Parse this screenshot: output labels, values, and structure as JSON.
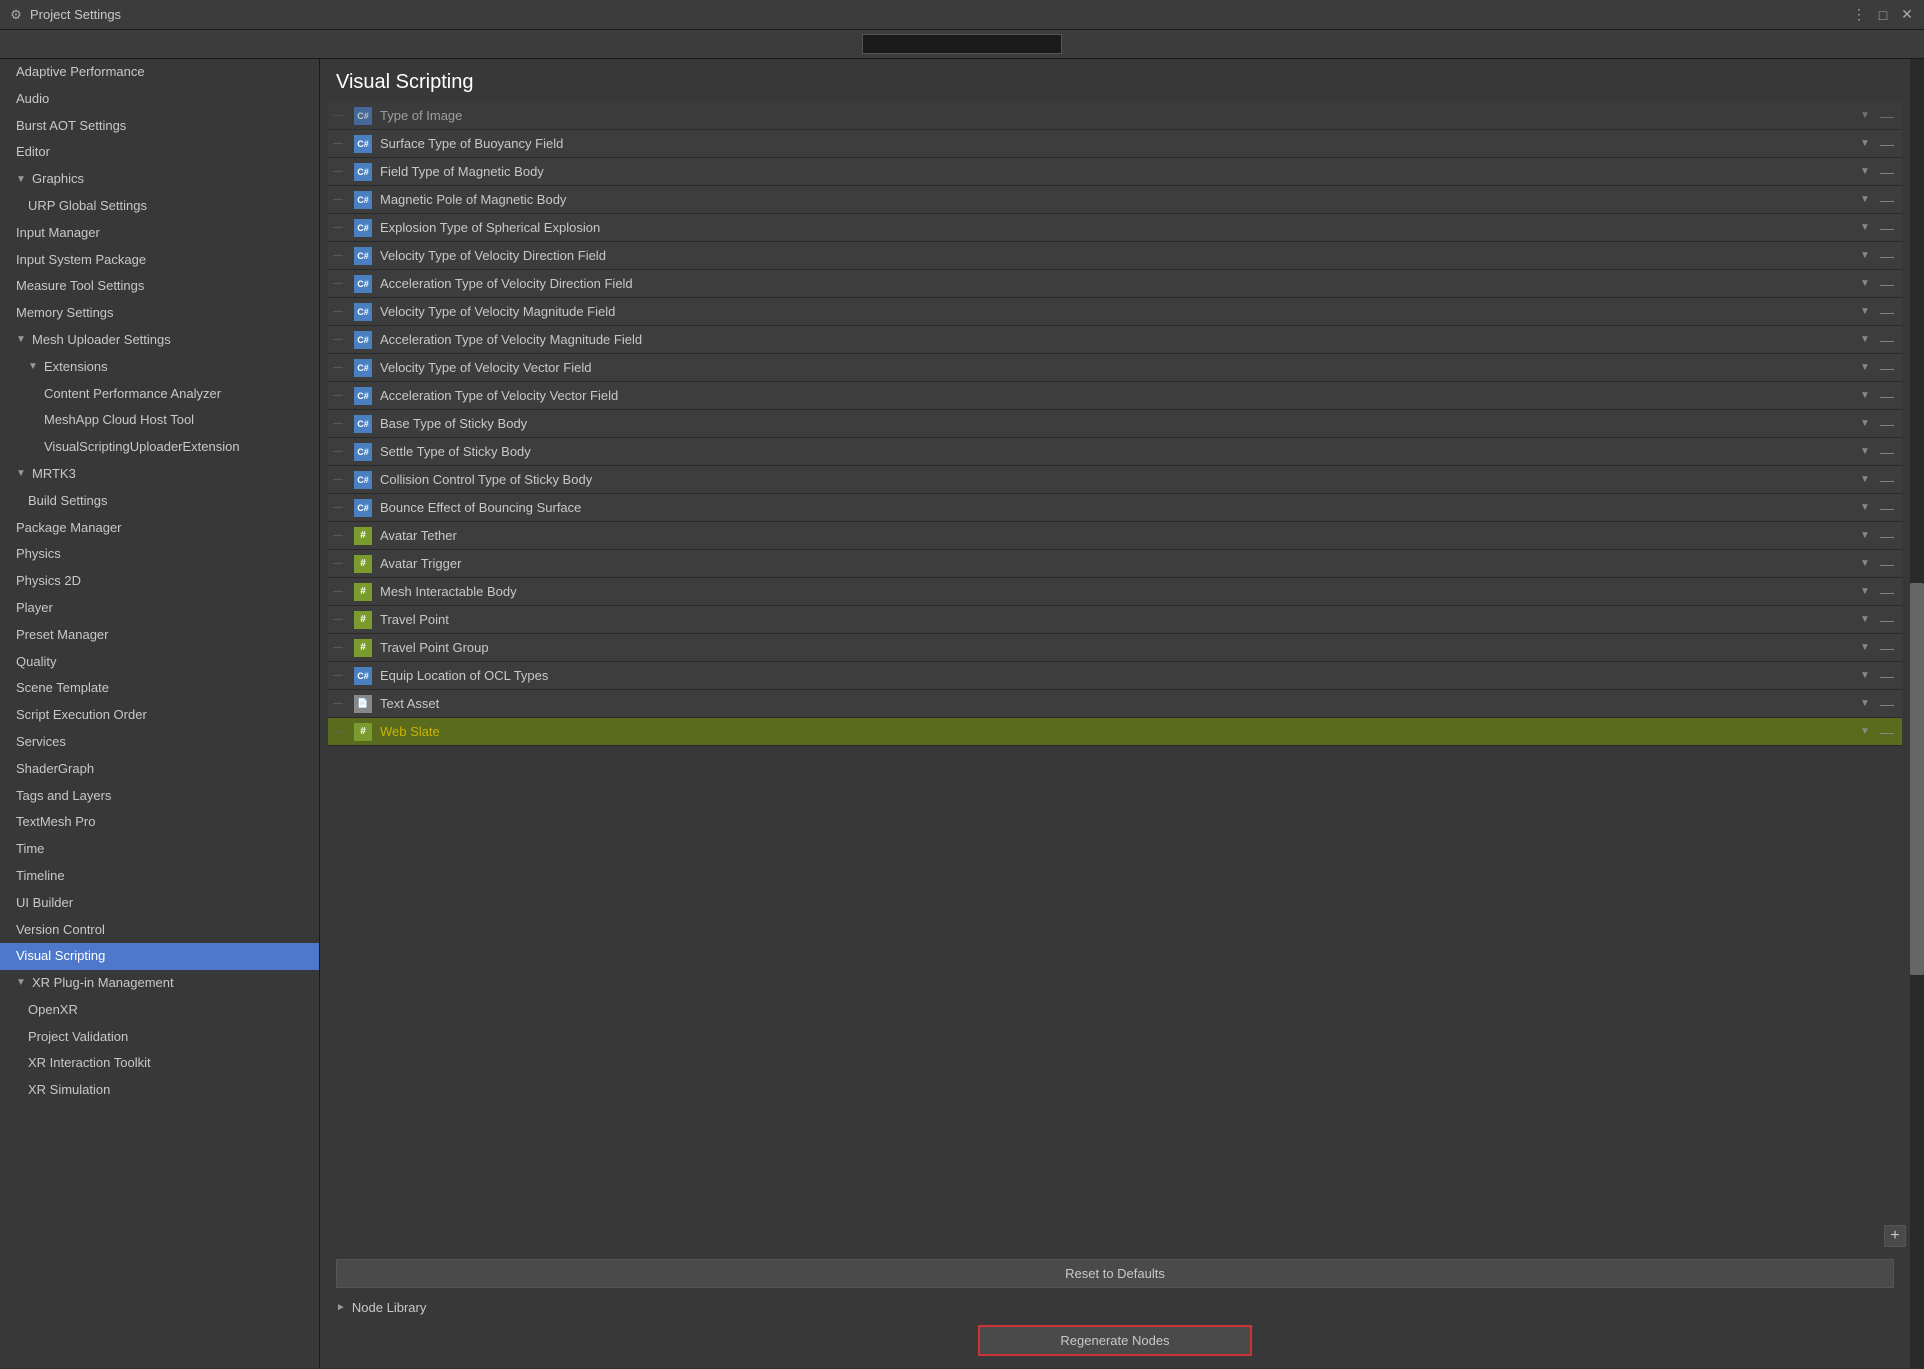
{
  "titlebar": {
    "title": "Project Settings",
    "icon": "⚙",
    "controls": [
      "⋮",
      "□",
      "✕"
    ]
  },
  "search": {
    "placeholder": ""
  },
  "sidebar": {
    "items": [
      {
        "id": "adaptive-performance",
        "label": "Adaptive Performance",
        "indent": 0,
        "arrow": null,
        "active": false
      },
      {
        "id": "audio",
        "label": "Audio",
        "indent": 0,
        "arrow": null,
        "active": false
      },
      {
        "id": "burst-aot-settings",
        "label": "Burst AOT Settings",
        "indent": 0,
        "arrow": null,
        "active": false
      },
      {
        "id": "editor",
        "label": "Editor",
        "indent": 0,
        "arrow": null,
        "active": false
      },
      {
        "id": "graphics",
        "label": "Graphics",
        "indent": 0,
        "arrow": "down",
        "active": false
      },
      {
        "id": "urp-global-settings",
        "label": "URP Global Settings",
        "indent": 1,
        "arrow": null,
        "active": false
      },
      {
        "id": "input-manager",
        "label": "Input Manager",
        "indent": 0,
        "arrow": null,
        "active": false
      },
      {
        "id": "input-system-package",
        "label": "Input System Package",
        "indent": 0,
        "arrow": null,
        "active": false
      },
      {
        "id": "measure-tool-settings",
        "label": "Measure Tool Settings",
        "indent": 0,
        "arrow": null,
        "active": false
      },
      {
        "id": "memory-settings",
        "label": "Memory Settings",
        "indent": 0,
        "arrow": null,
        "active": false
      },
      {
        "id": "mesh-uploader-settings",
        "label": "Mesh Uploader Settings",
        "indent": 0,
        "arrow": "down",
        "active": false
      },
      {
        "id": "extensions",
        "label": "Extensions",
        "indent": 1,
        "arrow": "down",
        "active": false
      },
      {
        "id": "content-performance-analyzer",
        "label": "Content Performance Analyzer",
        "indent": 2,
        "arrow": null,
        "active": false
      },
      {
        "id": "meshapp-cloud-host-tool",
        "label": "MeshApp Cloud Host Tool",
        "indent": 2,
        "arrow": null,
        "active": false
      },
      {
        "id": "visual-scripting-uploader",
        "label": "VisualScriptingUploaderExtension",
        "indent": 2,
        "arrow": null,
        "active": false
      },
      {
        "id": "mrtk3",
        "label": "MRTK3",
        "indent": 0,
        "arrow": "down",
        "active": false
      },
      {
        "id": "build-settings",
        "label": "Build Settings",
        "indent": 1,
        "arrow": null,
        "active": false
      },
      {
        "id": "package-manager",
        "label": "Package Manager",
        "indent": 0,
        "arrow": null,
        "active": false
      },
      {
        "id": "physics",
        "label": "Physics",
        "indent": 0,
        "arrow": null,
        "active": false
      },
      {
        "id": "physics-2d",
        "label": "Physics 2D",
        "indent": 0,
        "arrow": null,
        "active": false
      },
      {
        "id": "player",
        "label": "Player",
        "indent": 0,
        "arrow": null,
        "active": false
      },
      {
        "id": "preset-manager",
        "label": "Preset Manager",
        "indent": 0,
        "arrow": null,
        "active": false
      },
      {
        "id": "quality",
        "label": "Quality",
        "indent": 0,
        "arrow": null,
        "active": false
      },
      {
        "id": "scene-template",
        "label": "Scene Template",
        "indent": 0,
        "arrow": null,
        "active": false
      },
      {
        "id": "script-execution-order",
        "label": "Script Execution Order",
        "indent": 0,
        "arrow": null,
        "active": false
      },
      {
        "id": "services",
        "label": "Services",
        "indent": 0,
        "arrow": null,
        "active": false
      },
      {
        "id": "shader-graph",
        "label": "ShaderGraph",
        "indent": 0,
        "arrow": null,
        "active": false
      },
      {
        "id": "tags-and-layers",
        "label": "Tags and Layers",
        "indent": 0,
        "arrow": null,
        "active": false
      },
      {
        "id": "textmesh-pro",
        "label": "TextMesh Pro",
        "indent": 0,
        "arrow": null,
        "active": false
      },
      {
        "id": "time",
        "label": "Time",
        "indent": 0,
        "arrow": null,
        "active": false
      },
      {
        "id": "timeline",
        "label": "Timeline",
        "indent": 0,
        "arrow": null,
        "active": false
      },
      {
        "id": "ui-builder",
        "label": "UI Builder",
        "indent": 0,
        "arrow": null,
        "active": false
      },
      {
        "id": "version-control",
        "label": "Version Control",
        "indent": 0,
        "arrow": null,
        "active": false
      },
      {
        "id": "visual-scripting",
        "label": "Visual Scripting",
        "indent": 0,
        "arrow": null,
        "active": true
      },
      {
        "id": "xr-plug-in-management",
        "label": "XR Plug-in Management",
        "indent": 0,
        "arrow": "down",
        "active": false
      },
      {
        "id": "openxr",
        "label": "OpenXR",
        "indent": 1,
        "arrow": null,
        "active": false
      },
      {
        "id": "project-validation",
        "label": "Project Validation",
        "indent": 1,
        "arrow": null,
        "active": false
      },
      {
        "id": "xr-interaction-toolkit",
        "label": "XR Interaction Toolkit",
        "indent": 1,
        "arrow": null,
        "active": false
      },
      {
        "id": "xr-simulation",
        "label": "XR Simulation",
        "indent": 1,
        "arrow": null,
        "active": false
      }
    ]
  },
  "content": {
    "title": "Visual Scripting",
    "top_clipped_label": "Type of Image",
    "type_list": [
      {
        "id": "row1",
        "icon": "script",
        "label": "Surface Type of Buoyancy Field",
        "highlighted": false
      },
      {
        "id": "row2",
        "icon": "script",
        "label": "Field Type of Magnetic Body",
        "highlighted": false
      },
      {
        "id": "row3",
        "icon": "script",
        "label": "Magnetic Pole of Magnetic Body",
        "highlighted": false
      },
      {
        "id": "row4",
        "icon": "script",
        "label": "Explosion Type of Spherical Explosion",
        "highlighted": false
      },
      {
        "id": "row5",
        "icon": "script",
        "label": "Velocity Type of Velocity Direction Field",
        "highlighted": false
      },
      {
        "id": "row6",
        "icon": "script",
        "label": "Acceleration Type of Velocity Direction Field",
        "highlighted": false
      },
      {
        "id": "row7",
        "icon": "script",
        "label": "Velocity Type of Velocity Magnitude Field",
        "highlighted": false
      },
      {
        "id": "row8",
        "icon": "script",
        "label": "Acceleration Type of Velocity Magnitude Field",
        "highlighted": false
      },
      {
        "id": "row9",
        "icon": "script",
        "label": "Velocity Type of Velocity Vector Field",
        "highlighted": false
      },
      {
        "id": "row10",
        "icon": "script",
        "label": "Acceleration Type of Velocity Vector Field",
        "highlighted": false
      },
      {
        "id": "row11",
        "icon": "script",
        "label": "Base Type of Sticky Body",
        "highlighted": false
      },
      {
        "id": "row12",
        "icon": "script",
        "label": "Settle Type of Sticky Body",
        "highlighted": false
      },
      {
        "id": "row13",
        "icon": "script",
        "label": "Collision Control Type of Sticky Body",
        "highlighted": false
      },
      {
        "id": "row14",
        "icon": "script",
        "label": "Bounce Effect of Bouncing Surface",
        "highlighted": false
      },
      {
        "id": "row15",
        "icon": "hash",
        "label": "Avatar Tether",
        "highlighted": false
      },
      {
        "id": "row16",
        "icon": "hash",
        "label": "Avatar Trigger",
        "highlighted": false
      },
      {
        "id": "row17",
        "icon": "hash",
        "label": "Mesh Interactable Body",
        "highlighted": false
      },
      {
        "id": "row18",
        "icon": "hash",
        "label": "Travel Point",
        "highlighted": false
      },
      {
        "id": "row19",
        "icon": "hash",
        "label": "Travel Point Group",
        "highlighted": false
      },
      {
        "id": "row20",
        "icon": "script",
        "label": "Equip Location of OCL Types",
        "highlighted": false
      },
      {
        "id": "row21",
        "icon": "doc",
        "label": "Text Asset",
        "highlighted": false
      },
      {
        "id": "row22",
        "icon": "hash",
        "label": "Web Slate",
        "highlighted": true
      }
    ],
    "reset_button_label": "Reset to Defaults",
    "add_button_label": "+",
    "node_library_label": "Node Library",
    "regenerate_button_label": "Regenerate Nodes"
  }
}
